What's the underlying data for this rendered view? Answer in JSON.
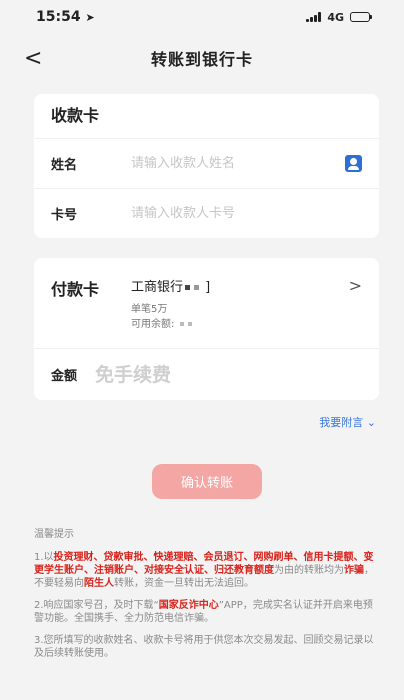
{
  "status": {
    "time": "15:54",
    "network": "4G",
    "battery_level": 0.6
  },
  "nav": {
    "back": "<",
    "title": "转账到银行卡"
  },
  "receive": {
    "title": "收款卡",
    "name_label": "姓名",
    "name_placeholder": "请输入收款人姓名",
    "card_label": "卡号",
    "card_placeholder": "请输入收款人卡号"
  },
  "pay": {
    "title": "付款卡",
    "bank_prefix": "工商银行",
    "bank_suffix": "]",
    "limit": "单笔5万",
    "balance_label": "可用余额:",
    "chevron": ">",
    "amount_label": "金额",
    "amount_placeholder": "免手续费"
  },
  "attach": {
    "label": "我要附言",
    "chevron": "⌄"
  },
  "confirm_label": "确认转账",
  "tips": {
    "title": "温馨提示",
    "t1_a": "1.以",
    "t1_red1": "投资理财、贷款审批、快递理赔、会员退订、网购刷单、信用卡提额、变更学生账户、注销账户、对接安全认证、归还教育额度",
    "t1_b": "为由的转账均为",
    "t1_red2": "诈骗",
    "t1_c": "，不要轻易向",
    "t1_red3": "陌生人",
    "t1_d": "转账，资金一旦转出无法追回。",
    "t2_a": "2.响应国家号召，及时下载“",
    "t2_red": "国家反诈中心",
    "t2_b": "”APP，完成实名认证并开启来电预警功能。全国携手、全力防范电信诈骗。",
    "t3": "3.您所填写的收款姓名、收款卡号将用于供您本次交易发起、回顾交易记录以及后续转账使用。"
  },
  "colors": {
    "accent_red": "#d8231c",
    "link_blue": "#3a76d8",
    "button": "#f3a6a4"
  }
}
